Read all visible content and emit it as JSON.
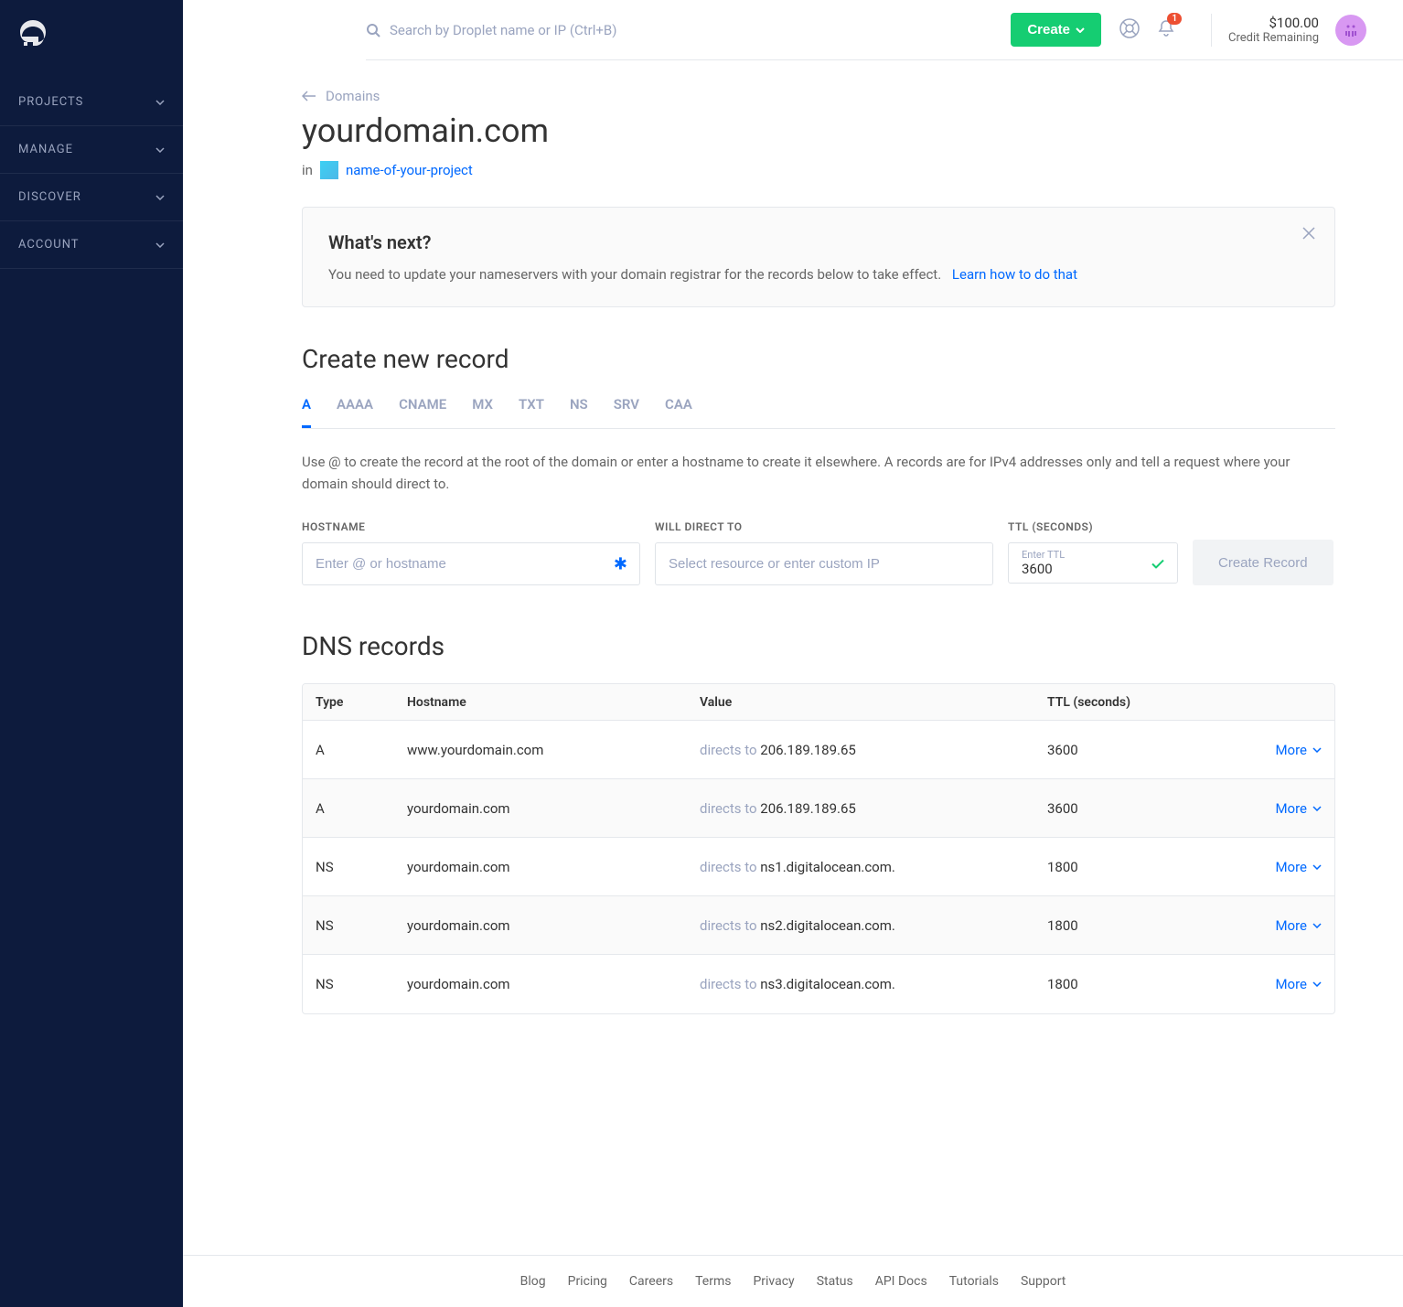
{
  "sidebar": {
    "items": [
      {
        "label": "PROJECTS"
      },
      {
        "label": "MANAGE"
      },
      {
        "label": "DISCOVER"
      },
      {
        "label": "ACCOUNT"
      }
    ]
  },
  "header": {
    "search_placeholder": "Search by Droplet name or IP (Ctrl+B)",
    "create_label": "Create",
    "notification_count": "1",
    "credit_amount": "$100.00",
    "credit_label": "Credit Remaining"
  },
  "breadcrumb": {
    "back_label": "Domains"
  },
  "page": {
    "title": "yourdomain.com",
    "in_label": "in",
    "project_name": "name-of-your-project"
  },
  "info_box": {
    "heading": "What's next?",
    "text": "You need to update your nameservers with your domain registrar for the records below to take effect.",
    "link": "Learn how to do that"
  },
  "create_record": {
    "title": "Create new record",
    "tabs": [
      "A",
      "AAAA",
      "CNAME",
      "MX",
      "TXT",
      "NS",
      "SRV",
      "CAA"
    ],
    "help_text": "Use @ to create the record at the root of the domain or enter a hostname to create it elsewhere. A records are for IPv4 addresses only and tell a request where your domain should direct to.",
    "hostname_label": "HOSTNAME",
    "hostname_placeholder": "Enter @ or hostname",
    "direct_label": "WILL DIRECT TO",
    "direct_placeholder": "Select resource or enter custom IP",
    "ttl_label": "TTL (SECONDS)",
    "ttl_inner_label": "Enter TTL",
    "ttl_value": "3600",
    "create_button": "Create Record"
  },
  "dns": {
    "title": "DNS records",
    "headers": {
      "type": "Type",
      "hostname": "Hostname",
      "value": "Value",
      "ttl": "TTL (seconds)"
    },
    "directs_label": "directs to",
    "more_label": "More",
    "records": [
      {
        "type": "A",
        "hostname": "www.yourdomain.com",
        "value": "206.189.189.65",
        "ttl": "3600"
      },
      {
        "type": "A",
        "hostname": "yourdomain.com",
        "value": "206.189.189.65",
        "ttl": "3600"
      },
      {
        "type": "NS",
        "hostname": "yourdomain.com",
        "value": "ns1.digitalocean.com.",
        "ttl": "1800"
      },
      {
        "type": "NS",
        "hostname": "yourdomain.com",
        "value": "ns2.digitalocean.com.",
        "ttl": "1800"
      },
      {
        "type": "NS",
        "hostname": "yourdomain.com",
        "value": "ns3.digitalocean.com.",
        "ttl": "1800"
      }
    ]
  },
  "footer": {
    "links": [
      "Blog",
      "Pricing",
      "Careers",
      "Terms",
      "Privacy",
      "Status",
      "API Docs",
      "Tutorials",
      "Support"
    ]
  }
}
